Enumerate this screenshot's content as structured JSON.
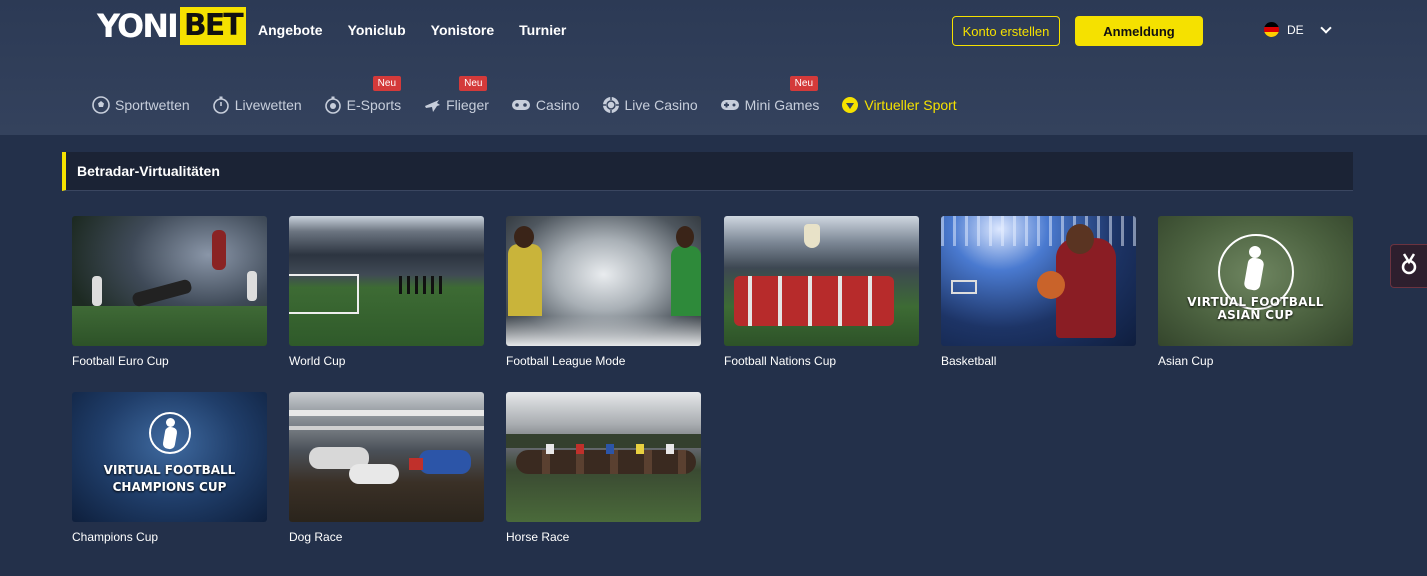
{
  "brand": {
    "part1": "YONI",
    "part2": "BET"
  },
  "top_nav": [
    {
      "label": "Angebote"
    },
    {
      "label": "Yoniclub"
    },
    {
      "label": "Yonistore"
    },
    {
      "label": "Turnier"
    }
  ],
  "auth": {
    "register_label": "Konto erstellen",
    "login_label": "Anmeldung"
  },
  "language": {
    "code": "DE",
    "flag_colors": [
      "#000000",
      "#dd0000",
      "#ffce00"
    ]
  },
  "sub_nav": [
    {
      "label": "Sportwetten",
      "icon": "soccer-ball-icon",
      "badge": ""
    },
    {
      "label": "Livewetten",
      "icon": "stopwatch-icon",
      "badge": ""
    },
    {
      "label": "E-Sports",
      "icon": "esports-icon",
      "badge": "Neu"
    },
    {
      "label": "Flieger",
      "icon": "plane-icon",
      "badge": "Neu"
    },
    {
      "label": "Casino",
      "icon": "gamepad-icon",
      "badge": ""
    },
    {
      "label": "Live Casino",
      "icon": "chip-icon",
      "badge": ""
    },
    {
      "label": "Mini Games",
      "icon": "controller-icon",
      "badge": "Neu"
    },
    {
      "label": "Virtueller Sport",
      "icon": "virtual-sport-icon",
      "badge": "",
      "active": true
    }
  ],
  "section": {
    "title": "Betradar-Virtualitäten"
  },
  "games": [
    {
      "label": "Football Euro Cup",
      "thumb_icon": "soccer-match-image"
    },
    {
      "label": "World Cup",
      "thumb_icon": "stadium-image"
    },
    {
      "label": "Football League Mode",
      "thumb_icon": "players-image"
    },
    {
      "label": "Football Nations Cup",
      "thumb_icon": "trophy-celebration-image"
    },
    {
      "label": "Basketball",
      "thumb_icon": "basketball-image"
    },
    {
      "label": "Asian Cup",
      "thumb_icon": "asian-cup-logo-image",
      "overlay": "VIRTUAL FOOTBALL\nASIAN CUP"
    },
    {
      "label": "Champions Cup",
      "thumb_icon": "champions-cup-logo-image",
      "overlay": "VIRTUAL FOOTBALL\nCHAMPIONS CUP"
    },
    {
      "label": "Dog Race",
      "thumb_icon": "greyhound-race-image"
    },
    {
      "label": "Horse Race",
      "thumb_icon": "horse-race-image"
    }
  ],
  "colors": {
    "accent": "#f5e100",
    "badge": "#d43a3a",
    "background": "#23304a"
  }
}
